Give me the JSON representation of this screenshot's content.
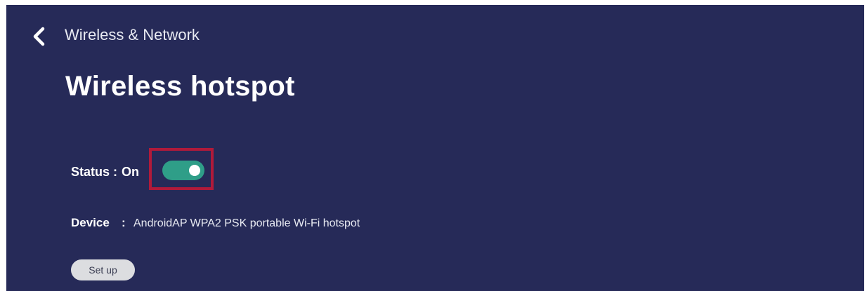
{
  "header": {
    "back_icon": "chevron-left-icon",
    "breadcrumb": "Wireless & Network"
  },
  "page": {
    "title": "Wireless hotspot"
  },
  "status": {
    "label": "Status :",
    "value": "On",
    "toggle_on": true,
    "toggle_color": "#2f9e88",
    "highlight_color": "#b01a3a"
  },
  "device": {
    "label": "Device",
    "separator": ":",
    "value": "AndroidAP WPA2 PSK portable Wi-Fi hotspot"
  },
  "actions": {
    "setup_label": "Set up"
  },
  "colors": {
    "background": "#262a58"
  }
}
